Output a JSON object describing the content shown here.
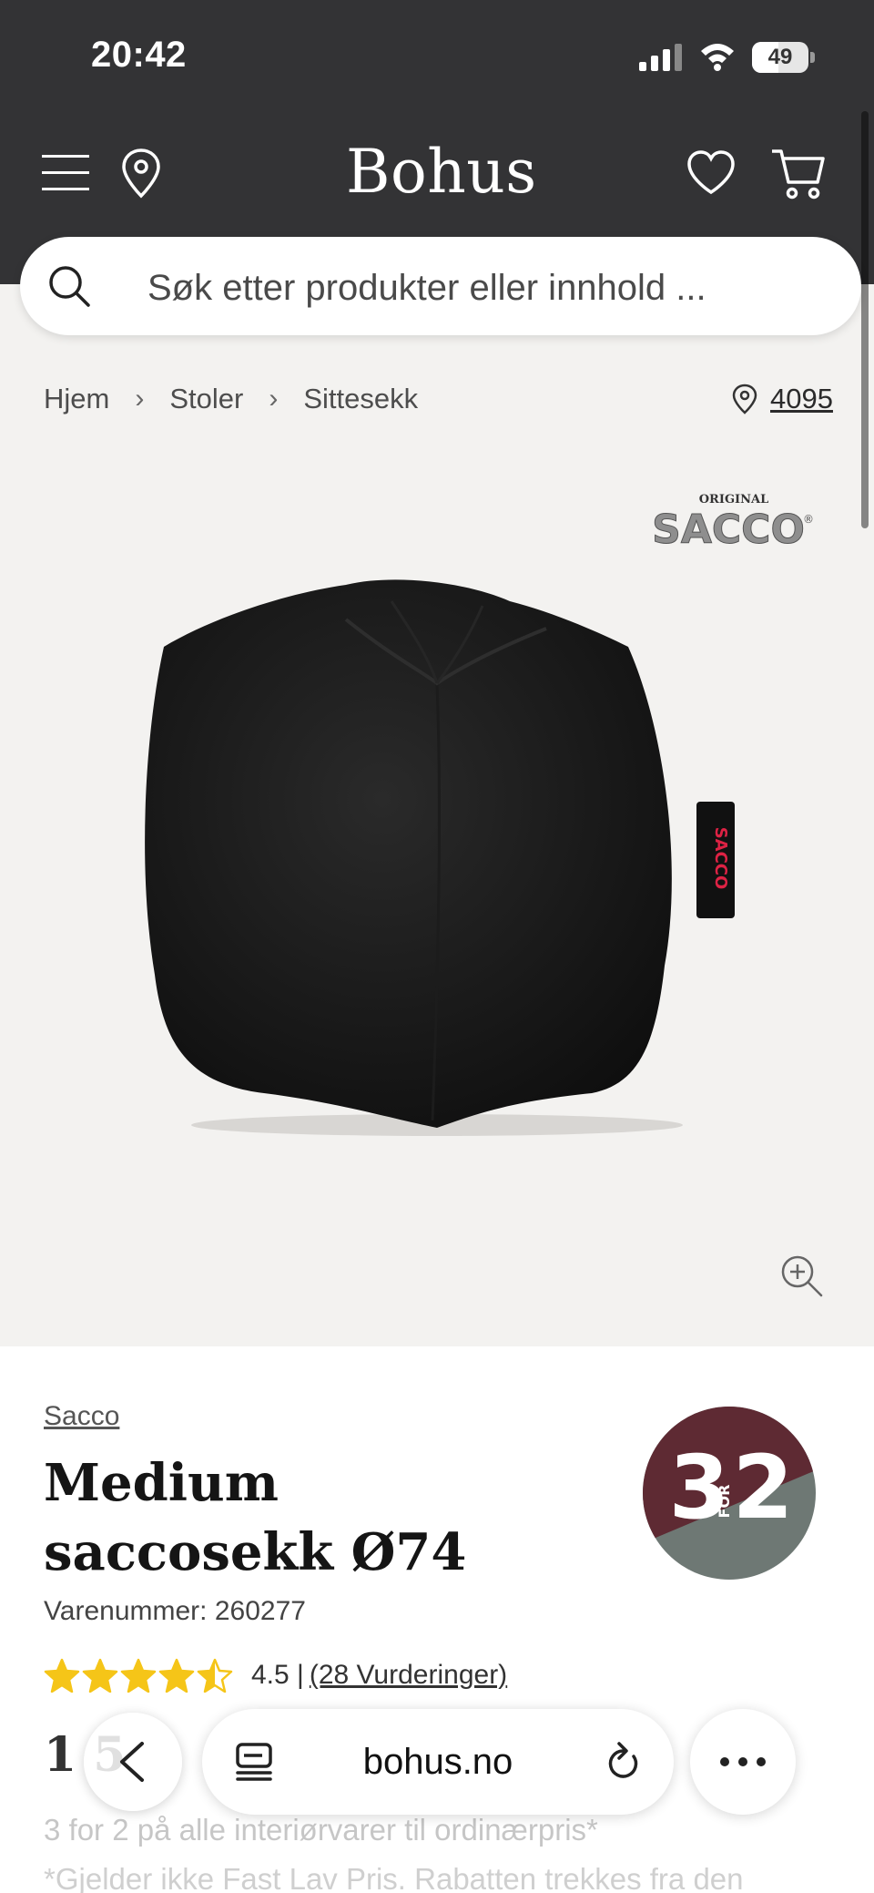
{
  "status_bar": {
    "time": "20:42",
    "battery": "49"
  },
  "header": {
    "logo": "Bohus"
  },
  "search": {
    "placeholder": "Søk etter produkter eller innhold ..."
  },
  "breadcrumb": {
    "items": [
      "Hjem",
      "Stoler",
      "Sittesekk"
    ],
    "store_number": "4095"
  },
  "product": {
    "brand_logo_text": "ORIGINAL SACCO",
    "brand": "Sacco",
    "title": "Medium saccosekk Ø74",
    "sku": "Varenummer: 260277",
    "rating_value": 4.5,
    "rating_text": "4.5 |",
    "reviews_link": "(28 Vurderinger)",
    "price_partial": "1 5",
    "badge": {
      "big1": "3",
      "small": "FOR",
      "big2": "2",
      "color_top": "#5e2a33",
      "color_bottom": "#6e7874"
    },
    "promo_line1": "3 for 2 på alle interiørvarer til ordinærpris*",
    "promo_line2": "*Gjelder ikke Fast Lav Pris. Rabatten trekkes fra den"
  },
  "browser": {
    "url": "bohus.no"
  },
  "colors": {
    "header_bg": "#333335",
    "page_bg": "#f3f2f0",
    "star": "#f5c518"
  },
  "icons": [
    "menu-icon",
    "location-pin-icon",
    "heart-icon",
    "cart-icon",
    "search-icon",
    "chevron-right-icon",
    "zoom-in-icon",
    "back-arrow-icon",
    "tabs-icon",
    "reload-icon",
    "more-icon"
  ]
}
